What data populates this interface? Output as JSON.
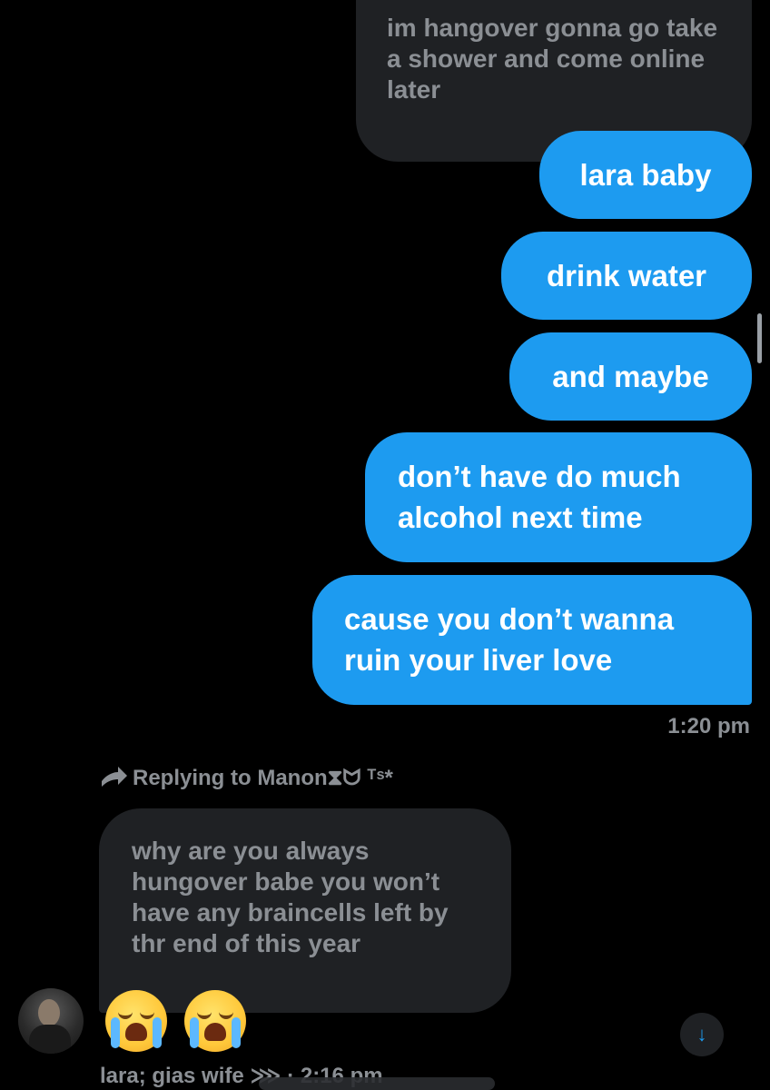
{
  "messages": {
    "in_top": "im hangover gonna go take a shower and come online later",
    "out": [
      "lara baby",
      "drink water",
      "and maybe",
      "don’t have do much alcohol next time",
      "cause you don’t wanna ruin your liver love"
    ],
    "out_time": "1:20 pm",
    "reply_label": "Replying to Manon⧗ᗢ ᵀˢ*",
    "in_reply": "why are you always hungover babe you won’t have any braincells left by thr end of this year",
    "reactions": [
      "😭",
      "😭"
    ],
    "sender_line": "lara; gias wife ⋙ · 2:16 pm"
  },
  "icons": {
    "reply": "reply-arrow-icon",
    "scroll_down": "arrow-down-icon",
    "scroll_down_glyph": "↓"
  },
  "colors": {
    "background": "#000000",
    "outgoing_bubble": "#1d9bf0",
    "incoming_bubble": "#1f2124",
    "muted_text": "#8b8f94"
  }
}
